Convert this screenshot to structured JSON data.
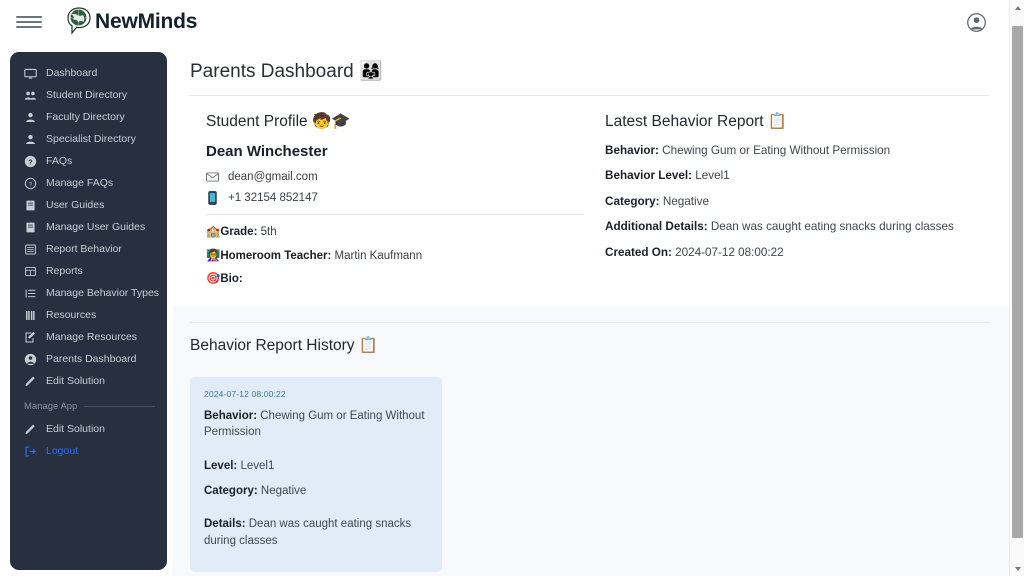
{
  "header": {
    "menu_icon": "hamburger-icon",
    "brand_name": "NewMinds",
    "brand_logo": "brain-globe-logo",
    "account_icon": "account-circle-icon"
  },
  "sidebar": {
    "items": [
      {
        "label": "Dashboard",
        "icon": "monitor-icon"
      },
      {
        "label": "Student Directory",
        "icon": "people-group-icon"
      },
      {
        "label": "Faculty Directory",
        "icon": "person-icon"
      },
      {
        "label": "Specialist Directory",
        "icon": "person-icon"
      },
      {
        "label": "FAQs",
        "icon": "question-circle-filled-icon"
      },
      {
        "label": "Manage FAQs",
        "icon": "question-circle-outline-icon"
      },
      {
        "label": "User Guides",
        "icon": "book-icon"
      },
      {
        "label": "Manage User Guides",
        "icon": "book-icon"
      },
      {
        "label": "Report Behavior",
        "icon": "list-table-icon"
      },
      {
        "label": "Reports",
        "icon": "table-icon"
      },
      {
        "label": "Manage Behavior Types",
        "icon": "list-ordered-icon"
      },
      {
        "label": "Resources",
        "icon": "books-icon"
      },
      {
        "label": "Manage Resources",
        "icon": "edit-square-icon"
      },
      {
        "label": "Parents Dashboard",
        "icon": "account-circle-icon"
      },
      {
        "label": "Edit Solution",
        "icon": "pencil-icon"
      }
    ],
    "section_label": "Manage App",
    "manage_items": [
      {
        "label": "Edit Solution",
        "icon": "pencil-icon"
      },
      {
        "label": "Logout",
        "icon": "logout-icon"
      }
    ],
    "logout_color": "#2f6fe4",
    "background_color": "#28303f"
  },
  "main": {
    "page_title": "Parents Dashboard",
    "page_title_emoji": "👨‍👩‍👧",
    "profile": {
      "section_title": "Student Profile",
      "section_emoji": "🧒🎓",
      "student_name": "Dean  Winchester",
      "email_icon": "envelope-icon",
      "email": "dean@gmail.com",
      "phone_icon": "mobile-phone-icon",
      "phone": "+1 32154 852147",
      "grade_emoji": "🏫",
      "grade_label": "Grade:",
      "grade_value": "5th",
      "teacher_emoji": "👩‍🏫",
      "teacher_label": "Homeroom Teacher:",
      "teacher_value": "Martin  Kaufmann",
      "bio_emoji": "🎯",
      "bio_label": "Bio:",
      "bio_value": ""
    },
    "latest_report": {
      "section_title": "Latest Behavior Report",
      "section_emoji": "📋",
      "behavior_label": "Behavior:",
      "behavior_value": "Chewing Gum or Eating Without Permission",
      "level_label": "Behavior Level:",
      "level_value": "Level1",
      "category_label": "Category:",
      "category_value": "Negative",
      "details_label": "Additional Details:",
      "details_value": "Dean was caught eating snacks during classes",
      "created_label": "Created On:",
      "created_value": "2024-07-12 08:00:22"
    },
    "history": {
      "section_title": "Behavior Report History",
      "section_emoji": "📋",
      "entries": [
        {
          "date": "2024-07-12 08:00:22",
          "behavior_label": "Behavior:",
          "behavior_value": "Chewing Gum or Eating Without Permission",
          "level_label": "Level:",
          "level_value": "Level1",
          "category_label": "Category:",
          "category_value": "Negative",
          "details_label": "Details:",
          "details_value": "Dean was caught eating snacks during classes"
        }
      ],
      "card_color": "#e1ecf8",
      "date_color": "#3a7a8f"
    }
  },
  "scrollbar": {
    "up_arrow": "scroll-up-arrow",
    "down_arrow": "scroll-down-arrow"
  }
}
